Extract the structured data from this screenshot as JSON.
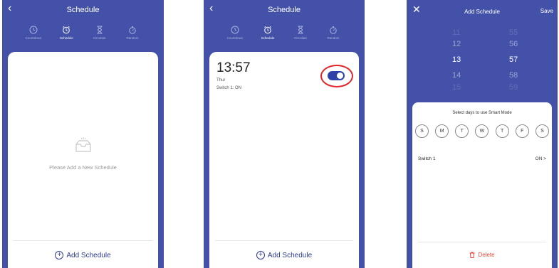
{
  "screen1": {
    "title": "Schedule",
    "back_icon": "chevron-left-icon",
    "tabs": [
      {
        "label": "Countdown",
        "icon": "clock-icon"
      },
      {
        "label": "Schedule",
        "icon": "alarm-icon"
      },
      {
        "label": "Circulate",
        "icon": "hourglass-icon"
      },
      {
        "label": "Random",
        "icon": "stopwatch-icon"
      }
    ],
    "empty_text": "Please Add a New Schedule",
    "add_label": "Add Schedule"
  },
  "screen2": {
    "title": "Schedule",
    "tabs": [
      {
        "label": "Countdown"
      },
      {
        "label": "Schedule"
      },
      {
        "label": "Circulate"
      },
      {
        "label": "Random"
      }
    ],
    "time": "13:57",
    "day": "Thur",
    "switch_status": "Switch 1: ON",
    "toggle_on": true,
    "add_label": "Add Schedule",
    "highlight_color": "#e0262b"
  },
  "screen3": {
    "title": "Add Schedule",
    "save_label": "Save",
    "picker": [
      {
        "hour": "11",
        "minute": "55"
      },
      {
        "hour": "12",
        "minute": "56"
      },
      {
        "hour": "13",
        "minute": "57"
      },
      {
        "hour": "14",
        "minute": "58"
      },
      {
        "hour": "15",
        "minute": "59"
      }
    ],
    "sheet_title": "Select days to use Smart Mode",
    "days": [
      "S",
      "M",
      "T",
      "W",
      "T",
      "F",
      "S"
    ],
    "switch_name": "Switch 1",
    "switch_value": "ON >",
    "delete_label": "Delete",
    "delete_color": "#e0473c"
  },
  "colors": {
    "accent": "#4352a8",
    "primary": "#2b3a8c"
  }
}
